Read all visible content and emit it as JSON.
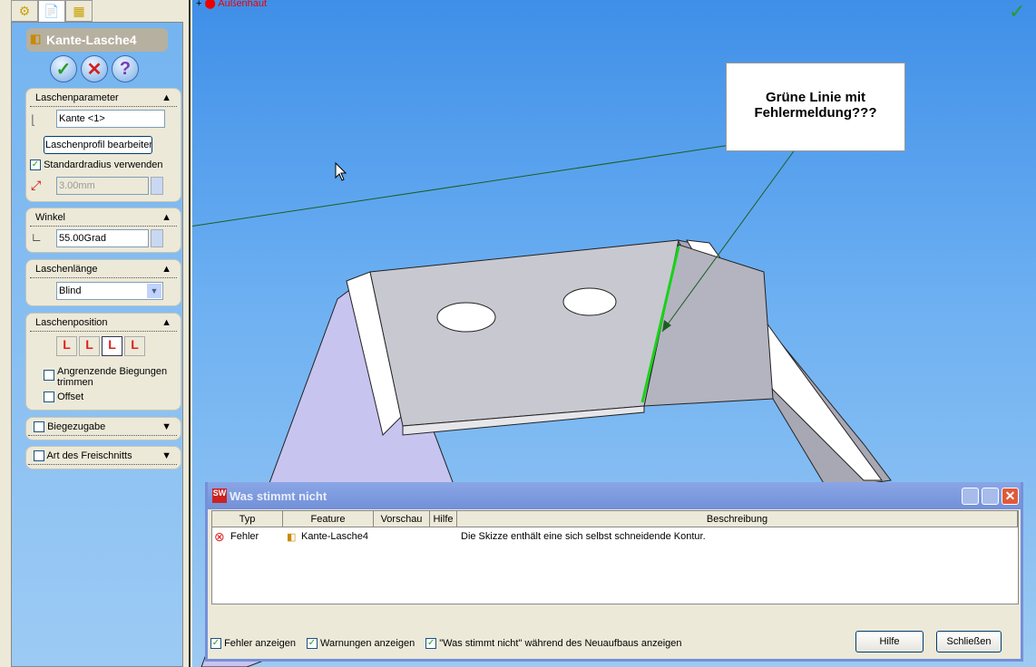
{
  "tree": {
    "item": "Außenhaut"
  },
  "panel": {
    "title": "Kante-Lasche4",
    "groups": {
      "laschenparameter": {
        "title": "Laschenparameter",
        "edge": "Kante <1>",
        "profile_button": "Laschenprofil bearbeiten",
        "std_radius": "Standardradius verwenden",
        "std_radius_checked": true,
        "radius": "3.00mm"
      },
      "winkel": {
        "title": "Winkel",
        "value": "55.00Grad"
      },
      "laenge": {
        "title": "Laschenlänge",
        "value": "Blind"
      },
      "position": {
        "title": "Laschenposition",
        "trim": "Angrenzende Biegungen trimmen",
        "offset": "Offset"
      },
      "biegezugabe": {
        "title": "Biegezugabe"
      },
      "freischnitt": {
        "title": "Art des Freischnitts"
      }
    }
  },
  "callout": {
    "text": "Grüne Linie mit Fehlermeldung???"
  },
  "dialog": {
    "title": "Was stimmt nicht",
    "columns": [
      "Typ",
      "Feature",
      "Vorschau",
      "Hilfe",
      "Beschreibung"
    ],
    "rows": [
      {
        "type": "Fehler",
        "feature": "Kante-Lasche4",
        "preview": "",
        "help": "",
        "description": "Die Skizze enthält eine sich selbst schneidende Kontur."
      }
    ],
    "checks": [
      "Fehler anzeigen",
      "Warnungen anzeigen",
      "\"Was stimmt nicht\" während des Neuaufbaus anzeigen"
    ],
    "help_button": "Hilfe",
    "close_button": "Schließen"
  }
}
